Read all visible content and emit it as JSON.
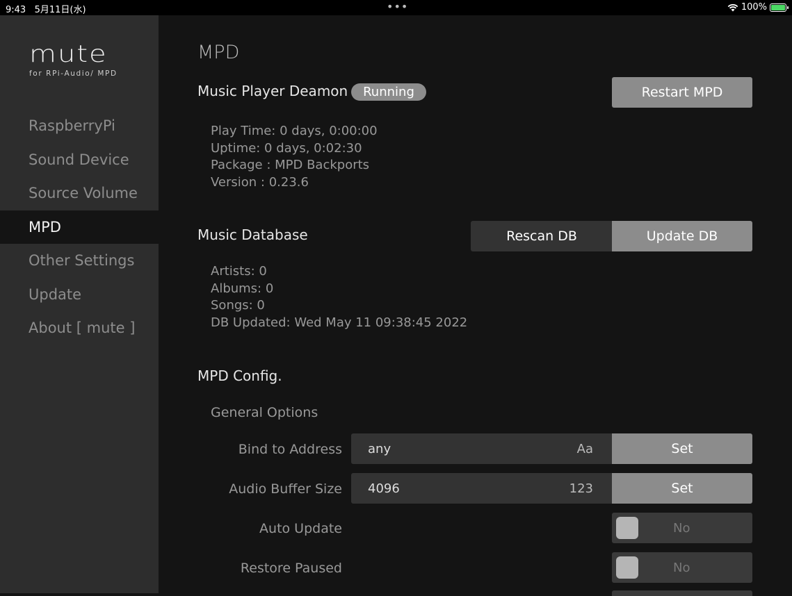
{
  "status_bar": {
    "time": "9:43",
    "date": "5月11日(水)",
    "battery": "100%",
    "dots": "•••"
  },
  "sidebar": {
    "logo": "mute",
    "logo_sub": "for RPi-Audio/ MPD",
    "items": [
      {
        "label": "RaspberryPi"
      },
      {
        "label": "Sound Device"
      },
      {
        "label": "Source Volume"
      },
      {
        "label": "MPD"
      },
      {
        "label": "Other Settings"
      },
      {
        "label": "Update"
      },
      {
        "label": "About [ mute ]"
      }
    ]
  },
  "main": {
    "title": "MPD",
    "daemon": {
      "title": "Music Player Deamon",
      "status": "Running",
      "restart_label": "Restart MPD",
      "info": [
        "Play Time: 0 days, 0:00:00",
        "Uptime: 0 days, 0:02:30",
        "Package : MPD Backports",
        "Version : 0.23.6"
      ]
    },
    "database": {
      "title": "Music Database",
      "rescan_label": "Rescan DB",
      "update_label": "Update DB",
      "info": [
        "Artists: 0",
        "Albums: 0",
        "Songs: 0",
        "DB Updated: Wed May 11 09:38:45 2022"
      ]
    },
    "config": {
      "title": "MPD Config.",
      "general_options": "General Options",
      "bind_address": {
        "label": "Bind to Address",
        "value": "any",
        "hint": "Aa",
        "button": "Set"
      },
      "audio_buffer": {
        "label": "Audio Buffer Size",
        "value": "4096",
        "hint": "123",
        "button": "Set"
      },
      "auto_update": {
        "label": "Auto Update",
        "value": "No"
      },
      "restore_paused": {
        "label": "Restore Paused",
        "value": "No"
      }
    }
  },
  "colors": {
    "background": "#141414",
    "sidebar": "#2d2d2d",
    "button": "#8c8c8c",
    "field": "#333333"
  }
}
